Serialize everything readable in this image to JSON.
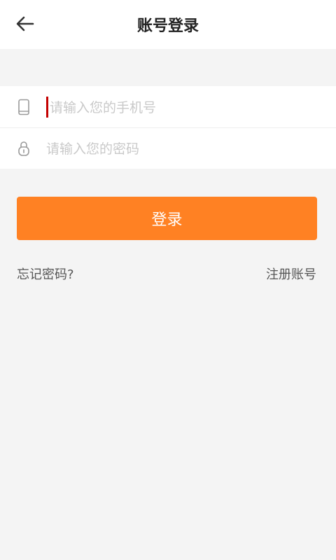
{
  "header": {
    "title": "账号登录",
    "back_icon": "arrow-left-icon"
  },
  "form": {
    "phone": {
      "placeholder": "请输入您的手机号",
      "icon": "phone-icon"
    },
    "password": {
      "placeholder": "请输入您的密码",
      "icon": "lock-icon"
    }
  },
  "actions": {
    "login_label": "登录",
    "forgot_label": "忘记密码?",
    "register_label": "注册账号"
  },
  "colors": {
    "accent": "#ff8123",
    "background": "#f4f4f4",
    "caret": "#c40000"
  }
}
